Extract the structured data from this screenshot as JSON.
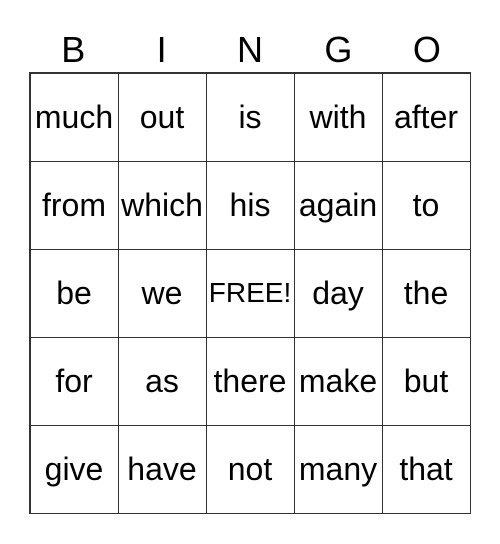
{
  "header": [
    "B",
    "I",
    "N",
    "G",
    "O"
  ],
  "cells": [
    [
      "much",
      "out",
      "is",
      "with",
      "after"
    ],
    [
      "from",
      "which",
      "his",
      "again",
      "to"
    ],
    [
      "be",
      "we",
      "FREE!",
      "day",
      "the"
    ],
    [
      "for",
      "as",
      "there",
      "make",
      "but"
    ],
    [
      "give",
      "have",
      "not",
      "many",
      "that"
    ]
  ]
}
